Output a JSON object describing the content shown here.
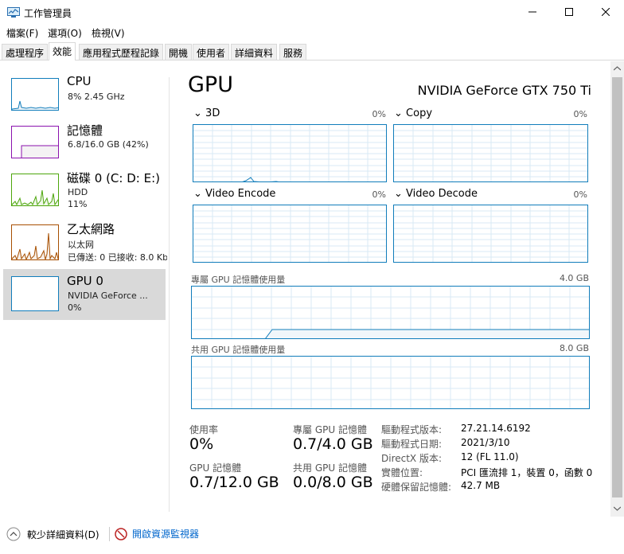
{
  "window": {
    "title": "工作管理員"
  },
  "menu": [
    "檔案(F)",
    "選項(O)",
    "檢視(V)"
  ],
  "tabs": [
    "處理程序",
    "效能",
    "應用程式歷程記錄",
    "開機",
    "使用者",
    "詳細資料",
    "服務"
  ],
  "devices": {
    "cpu": {
      "name": "CPU",
      "line1": "8%  2.45 GHz"
    },
    "memory": {
      "name": "記憶體",
      "line1": "6.8/16.0 GB (42%)"
    },
    "disk": {
      "name": "磁碟 0 (C: D: E:)",
      "line1": "HDD",
      "line2": "11%"
    },
    "ethernet": {
      "name": "乙太網路",
      "line1": "以太网",
      "line2": "已傳送: 0 已接收: 8.0 Kb"
    },
    "gpu": {
      "name": "GPU 0",
      "line1": "NVIDIA GeForce ...",
      "line2": "0%"
    }
  },
  "gpu": {
    "title": "GPU",
    "model": "NVIDIA GeForce GTX 750 Ti",
    "engines": [
      {
        "name": "3D",
        "pct": "0%"
      },
      {
        "name": "Copy",
        "pct": "0%"
      },
      {
        "name": "Video Encode",
        "pct": "0%"
      },
      {
        "name": "Video Decode",
        "pct": "0%"
      }
    ],
    "dedicated_label": "專屬 GPU 記憶體使用量",
    "dedicated_max": "4.0 GB",
    "shared_label": "共用 GPU 記憶體使用量",
    "shared_max": "8.0 GB"
  },
  "stats": {
    "usage_label": "使用率",
    "usage_value": "0%",
    "dedicated_mem_label": "專屬 GPU 記憶體",
    "dedicated_mem_value": "0.7/4.0 GB",
    "gpu_mem_label": "GPU 記憶體",
    "gpu_mem_value": "0.7/12.0 GB",
    "shared_mem_label": "共用 GPU 記憶體",
    "shared_mem_value": "0.0/8.0 GB"
  },
  "info": [
    {
      "key": "驅動程式版本:",
      "value": "27.21.14.6192"
    },
    {
      "key": "驅動程式日期:",
      "value": "2021/3/10"
    },
    {
      "key": "DirectX 版本:",
      "value": "12 (FL 11.0)"
    },
    {
      "key": "實體位置:",
      "value": "PCI 匯流排 1，裝置 0，函數 0"
    },
    {
      "key": "硬體保留記憶體:",
      "value": "42.7 MB"
    }
  ],
  "footer": {
    "fewer_details": "較少詳細資料(D)",
    "open_resmon": "開啟資源監視器"
  },
  "colors": {
    "cpu": "#117dbb",
    "memory": "#8b12ae",
    "disk": "#4da60c",
    "ethernet": "#a74f01",
    "gpu": "#117dbb"
  }
}
